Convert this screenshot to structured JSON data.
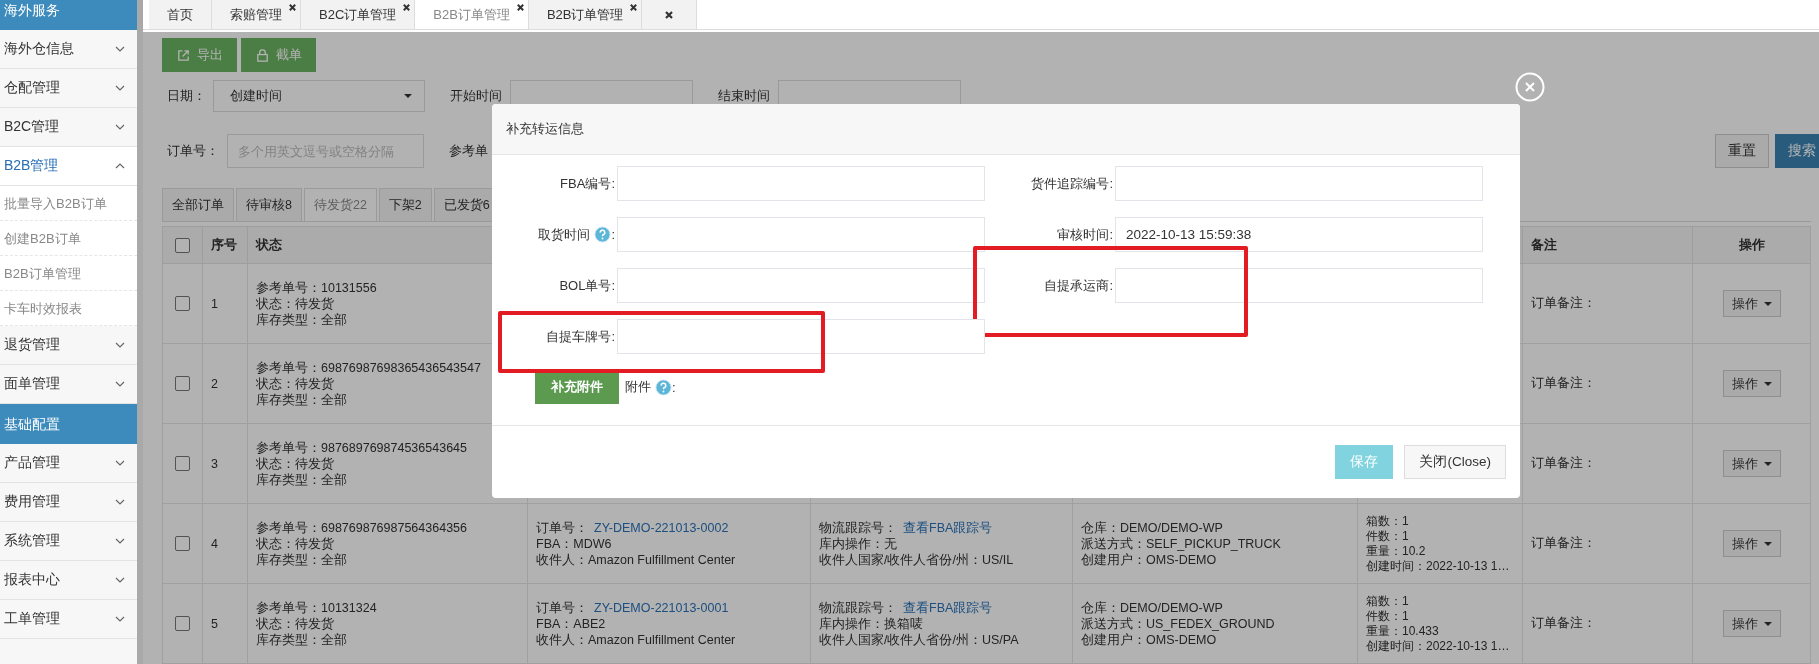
{
  "sidebar": {
    "sections": [
      {
        "title": "海外服务",
        "items": [
          {
            "label": "海外仓信息",
            "expanded": false
          },
          {
            "label": "仓配管理",
            "expanded": false
          },
          {
            "label": "B2C管理",
            "expanded": false
          },
          {
            "label": "B2B管理",
            "expanded": true,
            "children": [
              {
                "label": "批量导入B2B订单"
              },
              {
                "label": "创建B2B订单"
              },
              {
                "label": "B2B订单管理"
              },
              {
                "label": "卡车时效报表"
              }
            ]
          },
          {
            "label": "退货管理",
            "expanded": false
          },
          {
            "label": "面单管理",
            "expanded": false
          }
        ]
      },
      {
        "title": "基础配置",
        "items": [
          {
            "label": "产品管理",
            "expanded": false
          },
          {
            "label": "费用管理",
            "expanded": false
          },
          {
            "label": "系统管理",
            "expanded": false
          },
          {
            "label": "报表中心",
            "expanded": false
          },
          {
            "label": "工单管理",
            "expanded": false
          }
        ]
      }
    ]
  },
  "page_tabs": [
    {
      "label": "首页",
      "closable": false,
      "selected": false
    },
    {
      "label": "索赔管理",
      "closable": true,
      "selected": false
    },
    {
      "label": "B2C订单管理",
      "closable": true,
      "selected": false
    },
    {
      "label": "B2B订单管理",
      "closable": true,
      "selected": true
    },
    {
      "label": "B2B订单管理",
      "closable": true,
      "selected": false
    },
    {
      "closable": true,
      "selected": false
    }
  ],
  "toolbar": [
    {
      "label": "导出"
    },
    {
      "label": "截单"
    }
  ],
  "filters": {
    "date_label": "日期：",
    "date_select": "创建时间",
    "start_label": "开始时间",
    "end_label": "结束时间",
    "order_label": "订单号：",
    "order_placeholder": "多个用英文逗号或空格分隔",
    "ref_label": "参考单"
  },
  "actions": [
    {
      "label": "重置",
      "kind": "default"
    },
    {
      "label": "搜索",
      "kind": "primary"
    }
  ],
  "status_tabs": [
    {
      "label": "全部订单",
      "selected": false
    },
    {
      "label": "待审核8",
      "selected": false
    },
    {
      "label": "待发货22",
      "selected": true
    },
    {
      "label": "下架2",
      "selected": false
    },
    {
      "label": "已发货6",
      "selected": false
    }
  ],
  "table": {
    "select_all_checked": false,
    "columns": [
      {
        "kind": "index",
        "label": "序号"
      },
      {
        "kind": "status",
        "label": "状态"
      },
      {
        "kind": "order"
      },
      {
        "kind": "tracking"
      },
      {
        "kind": "warehouse"
      },
      {
        "kind": "counts"
      },
      {
        "kind": "note",
        "label": "备注"
      },
      {
        "kind": "action",
        "label": "操作"
      }
    ],
    "rows": [
      {
        "checked": false,
        "index": "1",
        "status_lines": [
          "参考单号：10131556",
          "状态：待发货",
          "库存类型：全部"
        ],
        "note": "订单备注：",
        "action": "操作"
      },
      {
        "checked": false,
        "index": "2",
        "status_lines": [
          "参考单号：69876987698365436543547",
          "状态：待发货",
          "库存类型：全部"
        ],
        "note": "订单备注：",
        "action": "操作"
      },
      {
        "checked": false,
        "index": "3",
        "status_lines": [
          "参考单号：987689769874536543645",
          "状态：待发货",
          "库存类型：全部"
        ],
        "note": "订单备注：",
        "action": "操作"
      },
      {
        "checked": false,
        "index": "4",
        "status_lines": [
          "参考单号：698769876987564364356",
          "状态：待发货",
          "库存类型：全部"
        ],
        "order": {
          "label": "订单号：",
          "link": "ZY-DEMO-221013-0002",
          "lines": [
            "FBA：MDW6",
            "收件人：Amazon Fulfillment Center"
          ]
        },
        "tracking": {
          "label": "物流跟踪号：",
          "link": "查看FBA跟踪号",
          "lines": [
            "库内操作：无",
            "收件人国家/收件人省份/州：US/IL"
          ]
        },
        "warehouse_lines": [
          "仓库：DEMO/DEMO-WP",
          "派送方式：SELF_PICKUP_TRUCK",
          "创建用户：OMS-DEMO"
        ],
        "counts_lines": [
          "箱数：1",
          "件数：1",
          "重量：10.2",
          "创建时间：2022-10-13 1…"
        ],
        "note": "订单备注：",
        "action": "操作"
      },
      {
        "checked": false,
        "index": "5",
        "status_lines": [
          "参考单号：10131324",
          "状态：待发货",
          "库存类型：全部"
        ],
        "order": {
          "label": "订单号：",
          "link": "ZY-DEMO-221013-0001",
          "lines": [
            "FBA：ABE2",
            "收件人：Amazon Fulfillment Center"
          ]
        },
        "tracking": {
          "label": "物流跟踪号：",
          "link": "查看FBA跟踪号",
          "lines": [
            "库内操作：换箱唛",
            "收件人国家/收件人省份/州：US/PA"
          ]
        },
        "warehouse_lines": [
          "仓库：DEMO/DEMO-WP",
          "派送方式：US_FEDEX_GROUND",
          "创建用户：OMS-DEMO"
        ],
        "counts_lines": [
          "箱数：1",
          "件数：1",
          "重量：10.433",
          "创建时间：2022-10-13 1…"
        ],
        "note": "订单备注：",
        "action": "操作"
      }
    ]
  },
  "modal": {
    "title": "补充转运信息",
    "fields": [
      {
        "label": "FBA编号:",
        "help": false,
        "highlighted": false
      },
      {
        "label": "货件追踪编号:",
        "help": false,
        "highlighted": false
      },
      {
        "label": "取货时间",
        "help": true,
        "suffix": ":",
        "highlighted": false
      },
      {
        "label": "审核时间:",
        "value": "2022-10-13 15:59:38",
        "help": false,
        "highlighted": false
      },
      {
        "label": "BOL单号:",
        "help": false,
        "highlighted": false
      },
      {
        "label": "自提承运商:",
        "help": false,
        "highlighted": true
      },
      {
        "label": "自提车牌号:",
        "help": false,
        "highlighted": true
      }
    ],
    "attach_button": "补充附件",
    "attach_label": "附件",
    "attach_suffix": ":",
    "buttons": [
      {
        "label": "保存",
        "kind": "primary"
      },
      {
        "label": "关闭(Close)",
        "kind": "default"
      }
    ]
  }
}
